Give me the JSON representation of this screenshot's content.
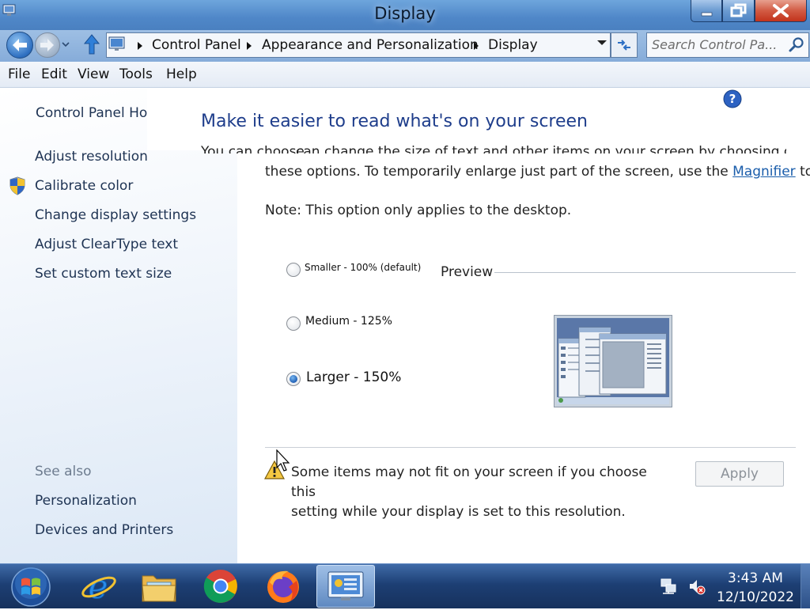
{
  "window": {
    "title": "Display",
    "controls": [
      "minimize",
      "maximize",
      "close"
    ]
  },
  "navigation": {
    "breadcrumbs": [
      "Control Panel",
      "Appearance and Personalization",
      "Display"
    ],
    "search_placeholder": "Search Control Pa..."
  },
  "menu": {
    "items": [
      "File",
      "Edit",
      "View",
      "Tools",
      "Help"
    ]
  },
  "sidebar": {
    "home": "Control Panel Hor",
    "links": [
      "Adjust resolution",
      "Calibrate color",
      "Change display settings",
      "Adjust ClearType text",
      "Set custom text size"
    ],
    "see_also_label": "See also",
    "see_also_links": [
      "Personalization",
      "Devices and Printers"
    ]
  },
  "main": {
    "heading": "Make it easier to read what's on your screen",
    "ghost_text_a": "You can choose",
    "ghost_text_b": "can change the size of text and other items on your screen by choosing one of",
    "description_line2_before": "these options. To temporarily enlarge just part of the screen, use the ",
    "magnifier_link": "Magnifier",
    "description_line2_after": " tool.",
    "note": "Note: This option only applies to the desktop.",
    "options": [
      {
        "label": "Smaller - 100% (default)",
        "checked": false
      },
      {
        "label": "Medium - 125%",
        "checked": false
      },
      {
        "label": "Larger - 150%",
        "checked": true
      }
    ],
    "preview_label": "Preview",
    "warning_line1": "Some items may not fit on your screen if you choose this",
    "warning_line2": "setting while your display is set to this resolution.",
    "apply_label": "Apply"
  },
  "taskbar": {
    "apps": [
      "internet-explorer",
      "file-explorer",
      "chrome",
      "firefox",
      "control-panel"
    ],
    "clock_time": "3:43 AM",
    "clock_date": "12/10/2022"
  },
  "colors": {
    "heading_blue": "#1e3d8b",
    "link_blue": "#1a5dab",
    "taskbar_blue": "#1d3f74"
  }
}
